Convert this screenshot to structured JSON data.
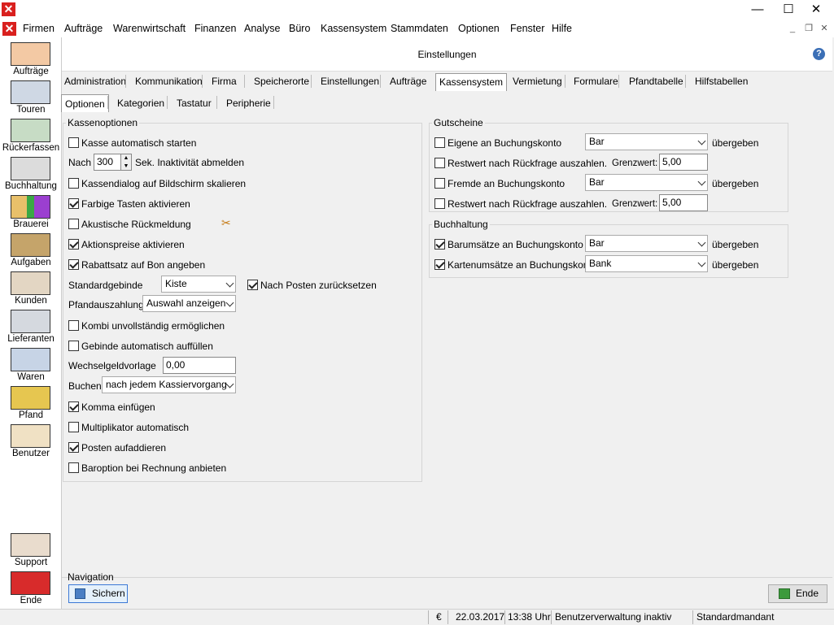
{
  "window": {
    "minimize": "—",
    "maximize": "☐",
    "close": "✕"
  },
  "menu": [
    "Firmen",
    "Aufträge",
    "Warenwirtschaft",
    "Finanzen",
    "Analyse",
    "Büro",
    "Kassensystem",
    "Stammdaten",
    "Optionen",
    "Fenster",
    "Hilfe"
  ],
  "sidebar": [
    "Aufträge",
    "Touren",
    "Rückerfassen",
    "Buchhaltung",
    "Brauerei",
    "Aufgaben",
    "Kunden",
    "Lieferanten",
    "Waren",
    "Pfand",
    "Benutzer"
  ],
  "sidebar_bottom": [
    "Support",
    "Ende"
  ],
  "header": {
    "title": "Einstellungen"
  },
  "tabs": [
    "Administration",
    "Kommunikation",
    "Firma",
    "Speicherorte",
    "Einstellungen",
    "Aufträge",
    "Kassensystem",
    "Vermietung",
    "Formulare",
    "Pfandtabelle",
    "Hilfstabellen"
  ],
  "subtabs": [
    "Optionen",
    "Kategorien",
    "Tastatur",
    "Peripherie"
  ],
  "kassenoptionen": {
    "title": "Kassenoptionen",
    "kasse_auto": "Kasse automatisch starten",
    "nach": "Nach",
    "nach_value": "300",
    "inaktiv": "Sek. Inaktivität abmelden",
    "skalieren": "Kassendialog auf Bildschirm skalieren",
    "farbig": "Farbige Tasten aktivieren",
    "akustisch": "Akustische Rückmeldung",
    "aktionspreise": "Aktionspreise aktivieren",
    "rabattsatz": "Rabattsatz auf Bon angeben",
    "standardgebinde": "Standardgebinde",
    "standardgebinde_value": "Kiste",
    "nach_posten": "Nach Posten zurücksetzen",
    "pfandauszahlung": "Pfandauszahlung",
    "pfandauszahlung_value": "Auswahl anzeigen",
    "kombi": "Kombi unvollständig ermöglichen",
    "gebinde_auto": "Gebinde automatisch auffüllen",
    "wechselgeld": "Wechselgeldvorlage",
    "wechselgeld_value": "0,00",
    "buchen": "Buchen",
    "buchen_value": "nach jedem Kassiervorgang",
    "komma": "Komma einfügen",
    "multiplikator": "Multiplikator automatisch",
    "posten": "Posten aufaddieren",
    "baroption": "Baroption bei Rechnung anbieten"
  },
  "gutscheine": {
    "title": "Gutscheine",
    "eigene": "Eigene an Buchungskonto",
    "eigene_value": "Bar",
    "uebergeben": "übergeben",
    "restwert": "Restwert nach Rückfrage auszahlen.",
    "grenzwert": "Grenzwert:",
    "grenzwert1": "5,00",
    "fremde": "Fremde an Buchungskonto",
    "fremde_value": "Bar",
    "grenzwert2": "5,00"
  },
  "buchhaltung": {
    "title": "Buchhaltung",
    "barumsaetze": "Barumsätze an Buchungskonto",
    "barumsaetze_value": "Bar",
    "karten": "Kartenumsätze an Buchungskonto",
    "karten_value": "Bank",
    "uebergeben": "übergeben"
  },
  "navigation": {
    "title": "Navigation",
    "save": "Sichern",
    "end": "Ende"
  },
  "status": {
    "currency": "€",
    "date": "22.03.2017",
    "time": "13:38 Uhr",
    "user": "Benutzerverwaltung inaktiv",
    "mandant": "Standardmandant"
  }
}
